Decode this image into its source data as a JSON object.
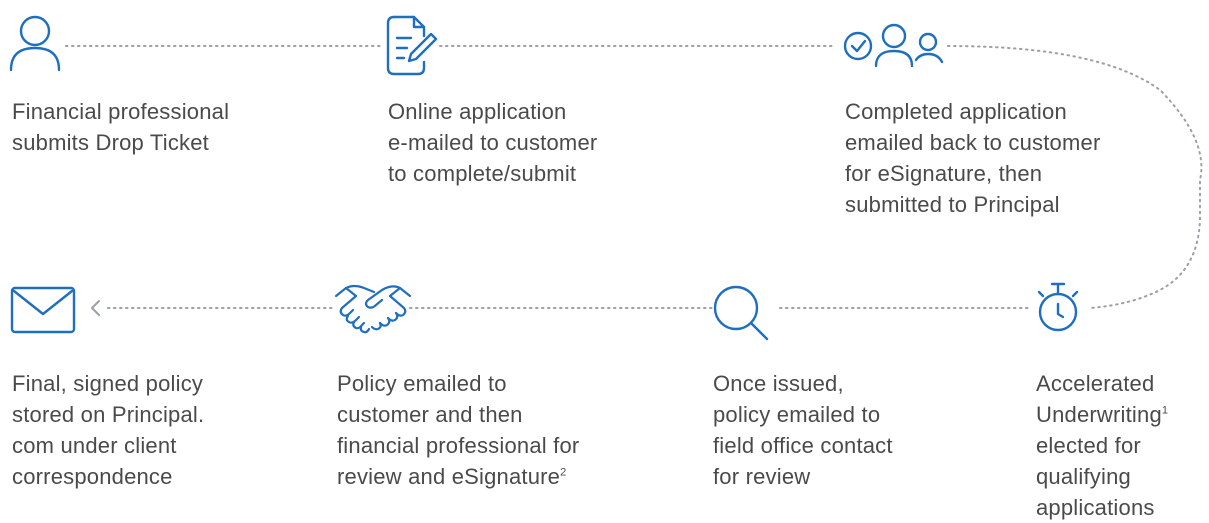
{
  "colors": {
    "accent": "#1f6fc1",
    "connector": "#9aa0a6",
    "text": "#4a4a4a"
  },
  "steps": [
    {
      "icon": "person-icon",
      "lines": [
        "Financial professional",
        "submits Drop Ticket"
      ]
    },
    {
      "icon": "document-edit-icon",
      "lines": [
        "Online application",
        "e-mailed to customer",
        "to complete/submit"
      ]
    },
    {
      "icon": "check-people-icon",
      "lines": [
        "Completed application",
        "emailed back to customer",
        "for eSignature, then",
        "submitted to Principal"
      ]
    },
    {
      "icon": "stopwatch-icon",
      "lines": [
        "Accelerated",
        "Underwriting",
        "elected for",
        "qualifying",
        "applications"
      ],
      "footnote": {
        "line": 1,
        "mark": "1"
      }
    },
    {
      "icon": "magnifier-icon",
      "lines": [
        "Once issued,",
        "policy emailed to",
        "field office contact",
        "for review"
      ]
    },
    {
      "icon": "handshake-icon",
      "lines": [
        "Policy emailed to",
        "customer and then",
        "financial professional for",
        "review and eSignature"
      ],
      "footnote": {
        "line": 3,
        "mark": "2"
      }
    },
    {
      "icon": "envelope-icon",
      "lines": [
        "Final, signed policy",
        "stored on Principal.",
        "com under client",
        "correspondence"
      ]
    }
  ]
}
